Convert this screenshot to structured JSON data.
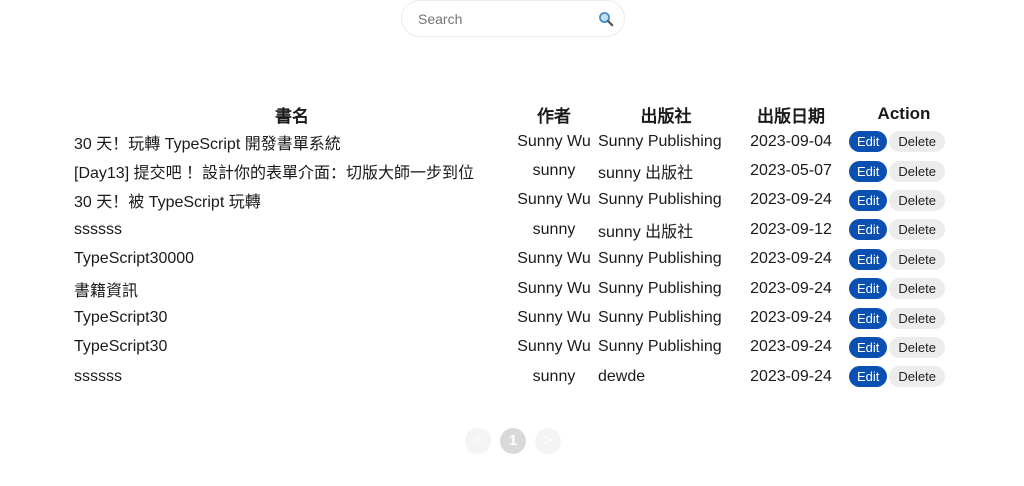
{
  "search": {
    "placeholder": "Search",
    "icon": "search-icon"
  },
  "table": {
    "headers": {
      "name": "書名",
      "author": "作者",
      "publisher": "出版社",
      "date": "出版日期",
      "action": "Action"
    },
    "rows": [
      {
        "name": "30 天！玩轉 TypeScript 開發書單系統",
        "author": "Sunny Wu",
        "publisher": "Sunny Publishing",
        "date": "2023-09-04"
      },
      {
        "name": "[Day13] 提交吧 ！設計你的表單介面：切版大師一步到位",
        "author": "sunny",
        "publisher": "sunny 出版社",
        "date": "2023-05-07"
      },
      {
        "name": "30 天！被 TypeScript 玩轉",
        "author": "Sunny Wu",
        "publisher": "Sunny Publishing",
        "date": "2023-09-24"
      },
      {
        "name": "ssssss",
        "author": "sunny",
        "publisher": "sunny 出版社",
        "date": "2023-09-12"
      },
      {
        "name": "TypeScript30000",
        "author": "Sunny Wu",
        "publisher": "Sunny Publishing",
        "date": "2023-09-24"
      },
      {
        "name": "書籍資訊",
        "author": "Sunny Wu",
        "publisher": "Sunny Publishing",
        "date": "2023-09-24"
      },
      {
        "name": "TypeScript30",
        "author": "Sunny Wu",
        "publisher": "Sunny Publishing",
        "date": "2023-09-24"
      },
      {
        "name": "TypeScript30",
        "author": "Sunny Wu",
        "publisher": "Sunny Publishing",
        "date": "2023-09-24"
      },
      {
        "name": "ssssss",
        "author": "sunny",
        "publisher": "dewde",
        "date": "2023-09-24"
      }
    ],
    "edit_label": "Edit",
    "delete_label": "Delete"
  },
  "pagination": {
    "prev_symbol": "<",
    "current_page": "1",
    "next_symbol": ">"
  },
  "colors": {
    "edit_button": "#0a4fb2",
    "delete_button": "#ececec",
    "page_current": "#d9d9d9",
    "page_inactive": "#f4f4f4"
  }
}
